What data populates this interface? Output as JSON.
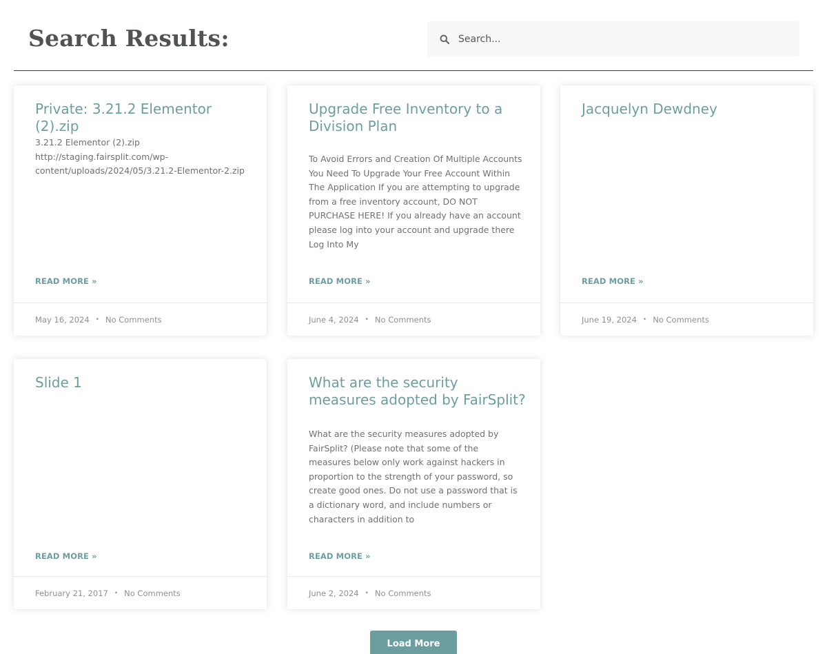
{
  "header": {
    "title": "Search Results:",
    "search_placeholder": "Search...",
    "search_icon": "search-icon"
  },
  "posts": [
    {
      "title": "Private: 3.21.2 Elementor (2).zip",
      "excerpt": "3.21.2 Elementor (2).zip http://staging.fairsplit.com/wp-content/uploads/2024/05/3.21.2-Elementor-2.zip",
      "read_more": "READ MORE »",
      "date": "May 16, 2024",
      "separator": "•",
      "comments": "No Comments"
    },
    {
      "title": "Upgrade Free Inventory to a Division Plan",
      "excerpt": "To Avoid Errors and Creation Of Multiple Accounts You Need To Upgrade Your Free Account Within The Application If you are attempting to upgrade from a free inventory account, DO NOT PURCHASE HERE! If you already have an account please log into your account and upgrade there Log Into My",
      "read_more": "READ MORE »",
      "date": "June 4, 2024",
      "separator": "•",
      "comments": "No Comments"
    },
    {
      "title": "Jacquelyn Dewdney",
      "excerpt": "",
      "read_more": "READ MORE »",
      "date": "June 19, 2024",
      "separator": "•",
      "comments": "No Comments"
    },
    {
      "title": "Slide 1",
      "excerpt": "",
      "read_more": "READ MORE »",
      "date": "February 21, 2017",
      "separator": "•",
      "comments": "No Comments"
    },
    {
      "title": "What are the security measures adopted by FairSplit?",
      "excerpt": "What are the security measures adopted by FairSplit? (Please note that some of the measures below only work against hackers in proportion to the strength of your password, so create good ones. Do not use a password that is a dictionary word, and include numbers or characters in addition to",
      "read_more": "READ MORE »",
      "date": "June 2, 2024",
      "separator": "•",
      "comments": "No Comments"
    }
  ],
  "load_more_label": "Load More",
  "colors": {
    "accent": "#6c9ea0",
    "heading": "#505356",
    "search_bg": "#f7f7f7"
  }
}
